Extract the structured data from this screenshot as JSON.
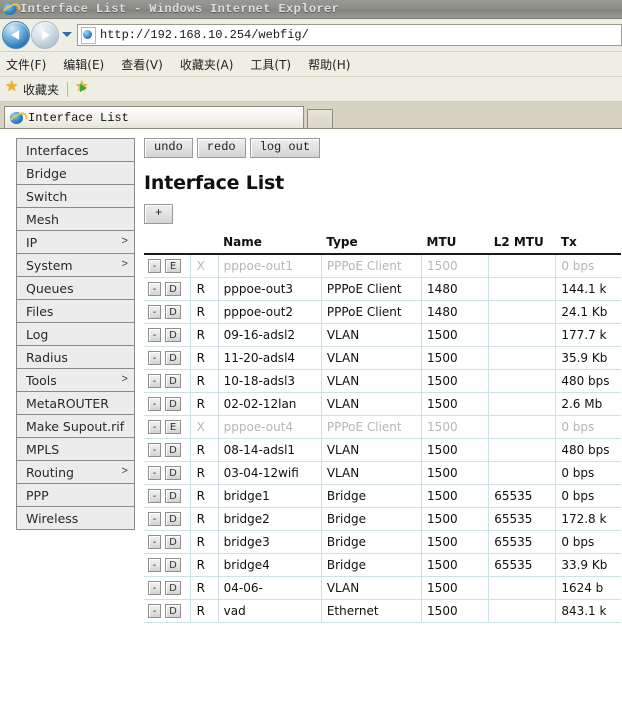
{
  "window": {
    "title": "Interface List - Windows Internet Explorer",
    "ie_icon": "ie-logo-icon"
  },
  "address_bar": {
    "url": "http://192.168.10.254/webfig/",
    "back_icon": "back-arrow-icon",
    "forward_icon": "forward-arrow-icon",
    "dropdown_icon": "chevron-down-icon",
    "page_icon": "page-favicon-icon"
  },
  "menu_bar": {
    "items": [
      {
        "label": "文件(F)"
      },
      {
        "label": "编辑(E)"
      },
      {
        "label": "查看(V)"
      },
      {
        "label": "收藏夹(A)"
      },
      {
        "label": "工具(T)"
      },
      {
        "label": "帮助(H)"
      }
    ]
  },
  "favorites_bar": {
    "star_icon": "star-icon",
    "label": "收藏夹",
    "add_favorite_icon": "add-to-favorites-icon"
  },
  "tabs": [
    {
      "label": "Interface List",
      "icon": "ie-page-icon"
    }
  ],
  "new_tab": {
    "label": ""
  },
  "sidebar": {
    "items": [
      {
        "label": "Interfaces",
        "chevron": ""
      },
      {
        "label": "Bridge",
        "chevron": ""
      },
      {
        "label": "Switch",
        "chevron": ""
      },
      {
        "label": "Mesh",
        "chevron": ""
      },
      {
        "label": "IP",
        "chevron": ">"
      },
      {
        "label": "System",
        "chevron": ">"
      },
      {
        "label": "Queues",
        "chevron": ""
      },
      {
        "label": "Files",
        "chevron": ""
      },
      {
        "label": "Log",
        "chevron": ""
      },
      {
        "label": "Radius",
        "chevron": ""
      },
      {
        "label": "Tools",
        "chevron": ">"
      },
      {
        "label": "MetaROUTER",
        "chevron": ""
      },
      {
        "label": "Make Supout.rif",
        "chevron": ""
      },
      {
        "label": "MPLS",
        "chevron": ""
      },
      {
        "label": "Routing",
        "chevron": ">"
      },
      {
        "label": "PPP",
        "chevron": ""
      },
      {
        "label": "Wireless",
        "chevron": ""
      }
    ]
  },
  "toolbar": {
    "undo_label": "undo",
    "redo_label": "redo",
    "logout_label": "log out"
  },
  "main": {
    "page_title": "Interface List",
    "add_label": "+"
  },
  "table": {
    "columns": [
      "",
      "",
      "Name",
      "Type",
      "MTU",
      "L2 MTU",
      "Tx"
    ],
    "rows": [
      {
        "remove": "-",
        "state": "E",
        "flag": "X",
        "name": "pppoe-out1",
        "type": "PPPoE Client",
        "mtu": "1500",
        "l2mtu": "",
        "tx": "0 bps",
        "disabled": true
      },
      {
        "remove": "-",
        "state": "D",
        "flag": "R",
        "name": "pppoe-out3",
        "type": "PPPoE Client",
        "mtu": "1480",
        "l2mtu": "",
        "tx": "144.1 k",
        "disabled": false
      },
      {
        "remove": "-",
        "state": "D",
        "flag": "R",
        "name": "pppoe-out2",
        "type": "PPPoE Client",
        "mtu": "1480",
        "l2mtu": "",
        "tx": "24.1 Kb",
        "disabled": false
      },
      {
        "remove": "-",
        "state": "D",
        "flag": "R",
        "name": "09-16-adsl2",
        "type": "VLAN",
        "mtu": "1500",
        "l2mtu": "",
        "tx": "177.7 k",
        "disabled": false
      },
      {
        "remove": "-",
        "state": "D",
        "flag": "R",
        "name": "11-20-adsl4",
        "type": "VLAN",
        "mtu": "1500",
        "l2mtu": "",
        "tx": "35.9 Kb",
        "disabled": false
      },
      {
        "remove": "-",
        "state": "D",
        "flag": "R",
        "name": "10-18-adsl3",
        "type": "VLAN",
        "mtu": "1500",
        "l2mtu": "",
        "tx": "480 bps",
        "disabled": false
      },
      {
        "remove": "-",
        "state": "D",
        "flag": "R",
        "name": "02-02-12lan",
        "type": "VLAN",
        "mtu": "1500",
        "l2mtu": "",
        "tx": "2.6 Mb",
        "disabled": false
      },
      {
        "remove": "-",
        "state": "E",
        "flag": "X",
        "name": "pppoe-out4",
        "type": "PPPoE Client",
        "mtu": "1500",
        "l2mtu": "",
        "tx": "0 bps",
        "disabled": true
      },
      {
        "remove": "-",
        "state": "D",
        "flag": "R",
        "name": "08-14-adsl1",
        "type": "VLAN",
        "mtu": "1500",
        "l2mtu": "",
        "tx": "480 bps",
        "disabled": false
      },
      {
        "remove": "-",
        "state": "D",
        "flag": "R",
        "name": "03-04-12wifi",
        "type": "VLAN",
        "mtu": "1500",
        "l2mtu": "",
        "tx": "0 bps",
        "disabled": false
      },
      {
        "remove": "-",
        "state": "D",
        "flag": "R",
        "name": "bridge1",
        "type": "Bridge",
        "mtu": "1500",
        "l2mtu": "65535",
        "tx": "0 bps",
        "disabled": false
      },
      {
        "remove": "-",
        "state": "D",
        "flag": "R",
        "name": "bridge2",
        "type": "Bridge",
        "mtu": "1500",
        "l2mtu": "65535",
        "tx": "172.8 k",
        "disabled": false
      },
      {
        "remove": "-",
        "state": "D",
        "flag": "R",
        "name": "bridge3",
        "type": "Bridge",
        "mtu": "1500",
        "l2mtu": "65535",
        "tx": "0 bps",
        "disabled": false
      },
      {
        "remove": "-",
        "state": "D",
        "flag": "R",
        "name": "bridge4",
        "type": "Bridge",
        "mtu": "1500",
        "l2mtu": "65535",
        "tx": "33.9 Kb",
        "disabled": false
      },
      {
        "remove": "-",
        "state": "D",
        "flag": "R",
        "name": "04-06-",
        "type": "VLAN",
        "mtu": "1500",
        "l2mtu": "",
        "tx": "1624 b",
        "disabled": false
      },
      {
        "remove": "-",
        "state": "D",
        "flag": "R",
        "name": "vad",
        "type": "Ethernet",
        "mtu": "1500",
        "l2mtu": "",
        "tx": "843.1 k",
        "disabled": false
      }
    ]
  },
  "colors": {
    "titlebar": "#8e8e88",
    "chrome": "#efeee4",
    "tabstrip": "#d6d3c3",
    "row_border": "#cfe0e6",
    "disabled_text": "#b6b6b6"
  }
}
